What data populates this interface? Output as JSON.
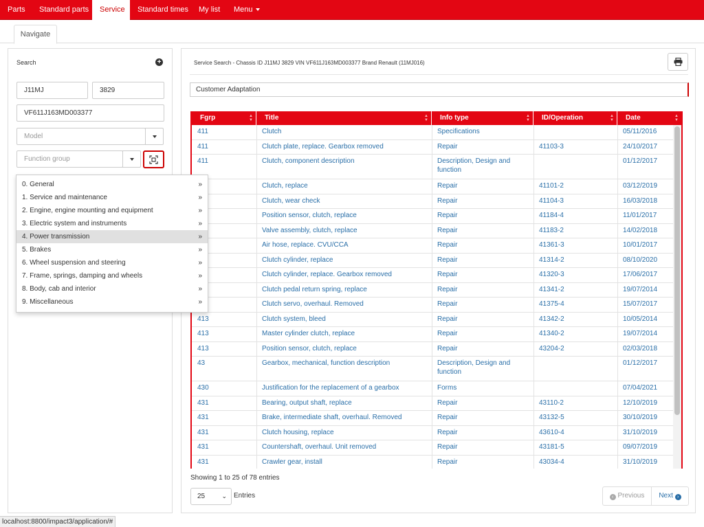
{
  "topnav": {
    "items": [
      {
        "label": "Parts"
      },
      {
        "label": "Standard parts"
      },
      {
        "label": "Service"
      },
      {
        "label": "Standard times"
      },
      {
        "label": "My list"
      },
      {
        "label": "Menu"
      }
    ],
    "active": "Service"
  },
  "tabs": {
    "navigate": "Navigate"
  },
  "search": {
    "title": "Search",
    "chassis_series": "J11MJ",
    "chassis_number": "3829",
    "vin": "VF611J163MD003377",
    "model_placeholder": "Model",
    "function_group_placeholder": "Function group"
  },
  "function_groups": [
    {
      "label": "0. General"
    },
    {
      "label": "1. Service and maintenance"
    },
    {
      "label": "2. Engine, engine mounting and equipment"
    },
    {
      "label": "3. Electric system and instruments"
    },
    {
      "label": "4. Power transmission"
    },
    {
      "label": "5. Brakes"
    },
    {
      "label": "6. Wheel suspension and steering"
    },
    {
      "label": "7. Frame, springs, damping and wheels"
    },
    {
      "label": "8. Body, cab and interior"
    },
    {
      "label": "9. Miscellaneous"
    }
  ],
  "function_group_highlighted": "4. Power transmission",
  "result": {
    "header": "Service Search - Chassis ID J11MJ 3829 VIN VF611J163MD003377 Brand Renault (11MJ016)",
    "customer_adaptation": "Customer Adaptation",
    "columns": [
      "Fgrp",
      "Title",
      "Info type",
      "ID/Operation",
      "Date"
    ],
    "rows": [
      {
        "fgrp": "411",
        "title": "Clutch",
        "info": "Specifications",
        "id": "",
        "date": "05/11/2016"
      },
      {
        "fgrp": "411",
        "title": "Clutch plate, replace. Gearbox removed",
        "info": "Repair",
        "id": "41103-3",
        "date": "24/10/2017"
      },
      {
        "fgrp": "411",
        "title": "Clutch, component description",
        "info": "Description, Design and function",
        "id": "",
        "date": "01/12/2017"
      },
      {
        "fgrp": "",
        "title": "Clutch, replace",
        "info": "Repair",
        "id": "41101-2",
        "date": "03/12/2019"
      },
      {
        "fgrp": "",
        "title": "Clutch, wear check",
        "info": "Repair",
        "id": "41104-3",
        "date": "16/03/2018"
      },
      {
        "fgrp": "",
        "title": "Position sensor, clutch, replace",
        "info": "Repair",
        "id": "41184-4",
        "date": "11/01/2017"
      },
      {
        "fgrp": "",
        "title": "Valve assembly, clutch, replace",
        "info": "Repair",
        "id": "41183-2",
        "date": "14/02/2018"
      },
      {
        "fgrp": "",
        "title": "Air hose, replace. CVU/CCA",
        "info": "Repair",
        "id": "41361-3",
        "date": "10/01/2017"
      },
      {
        "fgrp": "",
        "title": "Clutch cylinder, replace",
        "info": "Repair",
        "id": "41314-2",
        "date": "08/10/2020"
      },
      {
        "fgrp": "",
        "title": "Clutch cylinder, replace. Gearbox removed",
        "info": "Repair",
        "id": "41320-3",
        "date": "17/06/2017"
      },
      {
        "fgrp": "",
        "title": "Clutch pedal return spring, replace",
        "info": "Repair",
        "id": "41341-2",
        "date": "19/07/2014"
      },
      {
        "fgrp": "",
        "title": "Clutch servo, overhaul. Removed",
        "info": "Repair",
        "id": "41375-4",
        "date": "15/07/2017"
      },
      {
        "fgrp": "413",
        "title": "Clutch system, bleed",
        "info": "Repair",
        "id": "41342-2",
        "date": "10/05/2014"
      },
      {
        "fgrp": "413",
        "title": "Master cylinder clutch, replace",
        "info": "Repair",
        "id": "41340-2",
        "date": "19/07/2014"
      },
      {
        "fgrp": "413",
        "title": "Position sensor, clutch, replace",
        "info": "Repair",
        "id": "43204-2",
        "date": "02/03/2018"
      },
      {
        "fgrp": "43",
        "title": "Gearbox, mechanical, function description",
        "info": "Description, Design and function",
        "id": "",
        "date": "01/12/2017"
      },
      {
        "fgrp": "430",
        "title": "Justification for the replacement of a gearbox",
        "info": "Forms",
        "id": "",
        "date": "07/04/2021"
      },
      {
        "fgrp": "431",
        "title": "Bearing, output shaft, replace",
        "info": "Repair",
        "id": "43110-2",
        "date": "12/10/2019"
      },
      {
        "fgrp": "431",
        "title": "Brake, intermediate shaft, overhaul. Removed",
        "info": "Repair",
        "id": "43132-5",
        "date": "30/10/2019"
      },
      {
        "fgrp": "431",
        "title": "Clutch housing, replace",
        "info": "Repair",
        "id": "43610-4",
        "date": "31/10/2019"
      },
      {
        "fgrp": "431",
        "title": "Countershaft, overhaul. Unit removed",
        "info": "Repair",
        "id": "43181-5",
        "date": "09/07/2019"
      },
      {
        "fgrp": "431",
        "title": "Crawler gear, install",
        "info": "Repair",
        "id": "43034-4",
        "date": "31/10/2019"
      }
    ],
    "showing": "Showing 1 to 25 of 78 entries",
    "page_length": "25",
    "entries_label": "Entries",
    "prev_label": "Previous",
    "next_label": "Next"
  },
  "statusbar": "localhost:8800/impact3/application/#",
  "colors": {
    "accent": "#e30613",
    "link": "#2a6fa8"
  }
}
